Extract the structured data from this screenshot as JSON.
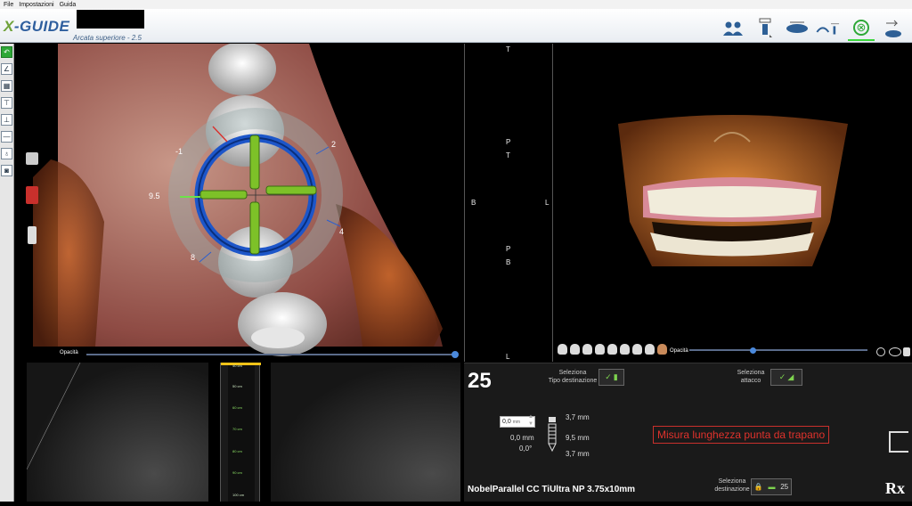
{
  "menu": {
    "items": [
      "File",
      "Impostazioni",
      "Guida"
    ]
  },
  "app": {
    "logo_x": "X",
    "logo_rest": "-GUIDE",
    "arch_label": "Arcata superiore - 2.5"
  },
  "toolbar": {
    "icons": [
      "patients-icon",
      "implant-select-icon",
      "arch-icon",
      "scan-tools-icon",
      "confirm-icon",
      "export-icon"
    ]
  },
  "main_view": {
    "angles": {
      "a1": "-1",
      "a2": "2",
      "a3": "9.5",
      "a4": "4",
      "a5": "8"
    },
    "opacity_label": "Opacità"
  },
  "mid_view": {
    "top": "T",
    "p1": "P",
    "t2": "T",
    "b_left": "B",
    "l_right": "L",
    "p2": "P",
    "b2": "B",
    "bottom": "L"
  },
  "view3d": {
    "opacity_label": "Opacità"
  },
  "ruler": {
    "marks": [
      "40 cm",
      "50 cm",
      "60 cm",
      "70 cm",
      "80 cm",
      "90 cm",
      "100 cm"
    ]
  },
  "panel": {
    "tooth_number": "25",
    "select_target_label": "Seleziona\nTipo destinazione",
    "select_attach_label": "Seleziona\nattacco",
    "offset_value": "0,0",
    "offset_unit": "mm",
    "dim_top": "3,7 mm",
    "dim_mid": "9,5 mm",
    "dim_bot": "3,7 mm",
    "depth_mm": "0,0 mm",
    "angle_deg": "0,0°",
    "warning": "Misura lunghezza punta da trapano",
    "implant_name": "NobelParallel CC TiUltra NP 3.75x10mm",
    "select_dest_label": "Seleziona\ndestinazione",
    "dest_value": "25",
    "rx": "Rx"
  }
}
